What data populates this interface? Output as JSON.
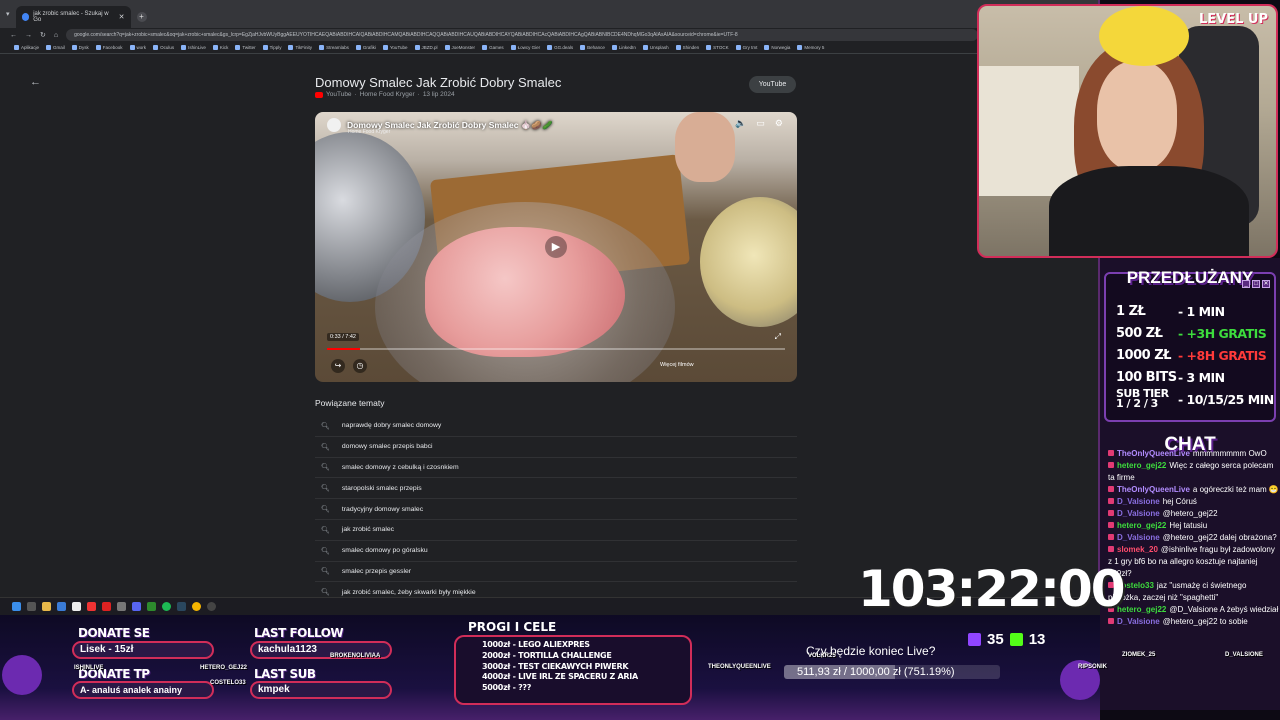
{
  "browser": {
    "tab_title": "jak zrobic smalec - Szukaj w Go",
    "address": "google.com/search?q=jak+zrobic+smalec&oq=jak+zrobic+smalec&gs_lcrp=EgZjaHJvbWUyBggAEEUYOTIHCAEQABiABDIHCAIQABiABDIHCAMQABiABDIHCAQQABiABDIHCAUQABiABDIHCAYQABiABDIHCAcQABiABDIHCAgQABiABNIBCDE4NDhqMGo3qAIAsAIA&sourceid=chrome&ie=UTF-8",
    "bookmarks": [
      "Aplikacje",
      "Gmail",
      "Dysk",
      "Facebook",
      "work",
      "Oculus",
      "IshinLive",
      "Kick",
      "Twitter",
      "Tipply",
      "TikFinity",
      "Streamlabs",
      "Grafiki",
      "YouTube",
      "JBZD.pl",
      "JoeMonster",
      "Games",
      "Łowcy Gier",
      "GG.deals",
      "Behance",
      "LinkedIn",
      "Unsplash",
      "Shinden",
      "STOCK",
      "Gry tmt",
      "Norwegia",
      "Memory 5"
    ]
  },
  "result": {
    "title": "Domowy Smalec Jak Zrobić Dobry Smalec",
    "source": "YouTube",
    "channel": "Home Food Kryger",
    "date": "13 lip 2024",
    "chip": "YouTube",
    "overlay_title": "Domowy Smalec Jak Zrobić Dobry Smalec 🧄🥔🥒",
    "overlay_channel": "Home Food Kryger",
    "time": "0:33 / 7:42",
    "progress_fraction": 0.071,
    "more_videos": "Więcej filmów"
  },
  "related": {
    "title": "Powiązane tematy",
    "items": [
      "naprawdę dobry smalec domowy",
      "domowy smalec przepis babci",
      "smalec domowy z cebulką i czosnkiem",
      "staropolski smalec przepis",
      "tradycyjny domowy smalec",
      "jak zrobić smalec",
      "smalec domowy po góralsku",
      "smalec przepis gessler",
      "jak zrobić smalec, żeby skwarki były miękkie"
    ]
  },
  "webcam": {
    "banner": "LEVEL UP"
  },
  "subs": {
    "title": "PRZEDŁUŻANY",
    "rows": [
      {
        "k": "1 ZŁ",
        "v": "- 1 MIN",
        "color": "#ffffff"
      },
      {
        "k": "500 ZŁ",
        "v": "- +3H GRATIS",
        "color": "#3ddc3d"
      },
      {
        "k": "1000 ZŁ",
        "v": "- +8H GRATIS",
        "color": "#ff3a3a"
      },
      {
        "k": "100 BITS",
        "v": "- 3 MIN",
        "color": "#ffffff"
      }
    ],
    "sub_tier_k": "SUB TIER",
    "sub_tier_k2": "1 / 2 / 3",
    "sub_tier_v": "- 10/15/25 MIN"
  },
  "chat": {
    "title": "CHAT",
    "messages": [
      {
        "user": "TheOnlyQueenLive",
        "text": "mmmmmmmm OwO",
        "color": "#b28cff"
      },
      {
        "user": "hetero_gej22",
        "text": "Więc z całego serca polecam ta firme",
        "color": "#3ddc3d"
      },
      {
        "user": "TheOnlyQueenLive",
        "text": "a ogóreczki też mam 😁",
        "color": "#b28cff"
      },
      {
        "user": "D_Valsione",
        "text": "hej Córuś",
        "color": "#8a6ee0"
      },
      {
        "user": "D_Valsione",
        "text": "@hetero_gej22",
        "color": "#8a6ee0"
      },
      {
        "user": "hetero_gej22",
        "text": "Hej tatusiu",
        "color": "#3ddc3d"
      },
      {
        "user": "D_Valsione",
        "text": "@hetero_gej22 dalej obrażona?",
        "color": "#8a6ee0"
      },
      {
        "user": "slomek_20",
        "text": "@ishinlive fragu był zadowolony z 1 gry bf6 bo na allegro kosztuje najtaniej 129zł?",
        "color": "#ff4d6d"
      },
      {
        "user": "costelo33",
        "text": "jaz \"usmażę ci świetnego pierożka, zaczej niż \"spaghetti\"",
        "color": "#3ddc3d"
      },
      {
        "user": "hetero_gej22",
        "text": "@D_Valsione A żebyś wiedział",
        "color": "#3ddc3d"
      },
      {
        "user": "D_Valsione",
        "text": "@hetero_gej22 to sobie",
        "color": "#8a6ee0"
      }
    ]
  },
  "timer": "103:22:00",
  "bottom": {
    "donate_label": "DONATE SE",
    "donate_value": "Lisek - 15zł",
    "donate_tp_label": "DONATE TP",
    "donate_tp_value": "A- analuś analek anainy",
    "last_follow_label": "LAST FOLLOW",
    "last_follow_value": "kachula1123",
    "last_sub_label": "LAST SUB",
    "last_sub_value": "kmpek",
    "goals_title": "PROGI I CELE",
    "goals": [
      "1000zł - LEGO ALIEXPRES",
      "2000zł - TORTILLA CHALLENGE",
      "3000zł - TEST CIEKAWYCH PIWERK",
      "4000zł - LIVE IRL ZE SPACERU Z ARIA",
      "5000zł - ???"
    ],
    "live_end_q": "Czy będzie koniec Live?",
    "goal_text": "511,93 zł / 1000,00 zł (751.19%)",
    "goal_fraction": 0.512,
    "viewers": "35",
    "kick_count": "13",
    "floating_names": [
      "ISHINLIVE",
      "HETERO_GEJ22",
      "COSTELO33",
      "BROKENOLIVIAA",
      "THEONLYQUEENLIVE",
      "VOLKR25",
      "ZIOMEK_25",
      "RIPSONIK",
      "D_VALSIONE"
    ]
  }
}
